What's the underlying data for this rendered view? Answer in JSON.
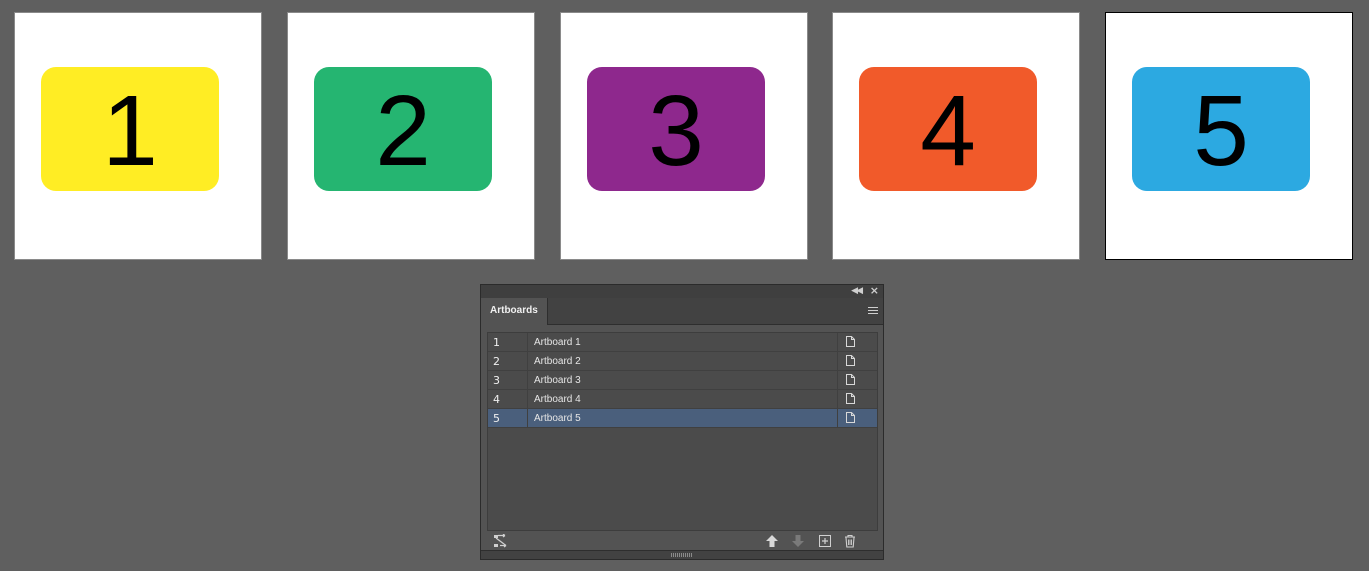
{
  "artboards": [
    {
      "number": "1",
      "color": "#FFED24",
      "selected": false
    },
    {
      "number": "2",
      "color": "#25B571",
      "selected": false
    },
    {
      "number": "3",
      "color": "#8E288D",
      "selected": false
    },
    {
      "number": "4",
      "color": "#F15A2A",
      "selected": false
    },
    {
      "number": "5",
      "color": "#2CA9E1",
      "selected": true
    }
  ],
  "panel": {
    "tab_label": "Artboards",
    "collapse_icon": "collapse-double-arrow-icon",
    "close_icon": "close-icon",
    "menu_icon": "panel-menu-icon",
    "selected_row_color": "#4A5F7C",
    "rows": [
      {
        "number": "1",
        "name": "Artboard 1",
        "icon": "artboard-options-icon"
      },
      {
        "number": "2",
        "name": "Artboard 2",
        "icon": "artboard-options-icon"
      },
      {
        "number": "3",
        "name": "Artboard 3",
        "icon": "artboard-options-icon"
      },
      {
        "number": "4",
        "name": "Artboard 4",
        "icon": "artboard-options-icon"
      },
      {
        "number": "5",
        "name": "Artboard 5",
        "icon": "artboard-options-icon",
        "selected": true
      }
    ],
    "footer_icons": [
      "rearrange-artboards-icon",
      "move-up-icon",
      "move-down-icon",
      "new-artboard-icon",
      "delete-artboard-icon"
    ]
  }
}
